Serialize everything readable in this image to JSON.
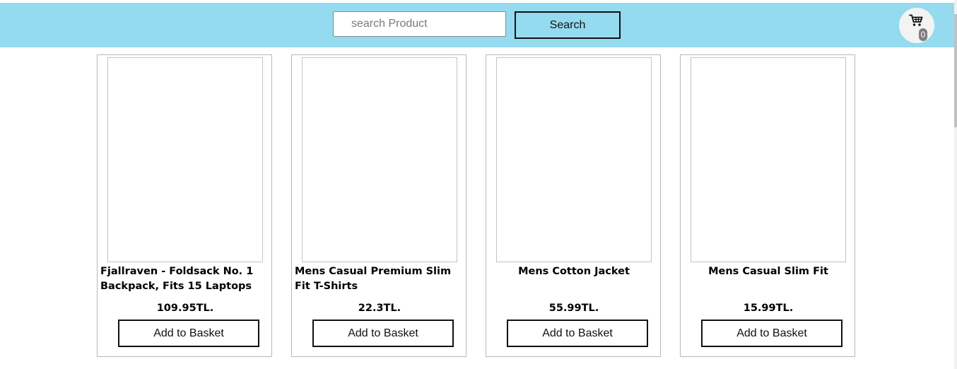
{
  "header": {
    "search_placeholder": "search Product",
    "search_value": "",
    "search_button_label": "Search",
    "cart_count": "0",
    "background_color": "#94dbf0"
  },
  "products": [
    {
      "title": "Fjallraven - Foldsack No. 1 Backpack, Fits 15 Laptops",
      "price": "109.95TL.",
      "button_label": "Add to Basket"
    },
    {
      "title": "Mens Casual Premium Slim Fit T-Shirts",
      "price": "22.3TL.",
      "button_label": "Add to Basket"
    },
    {
      "title": "Mens Cotton Jacket",
      "price": "55.99TL.",
      "button_label": "Add to Basket"
    },
    {
      "title": "Mens Casual Slim Fit",
      "price": "15.99TL.",
      "button_label": "Add to Basket"
    }
  ]
}
